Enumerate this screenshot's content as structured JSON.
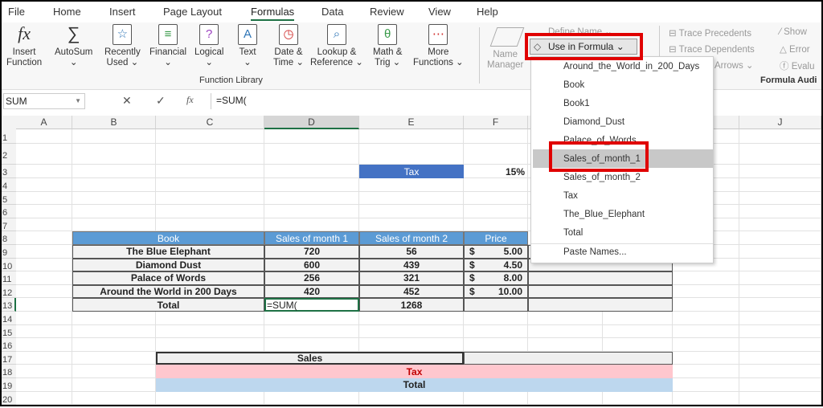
{
  "tabs": [
    "File",
    "Home",
    "Insert",
    "Page Layout",
    "Formulas",
    "Data",
    "Review",
    "View",
    "Help"
  ],
  "active_tab": "Formulas",
  "ribbon": {
    "function_library": [
      {
        "l1": "Insert",
        "l2": "Function",
        "icon": "fx-icon"
      },
      {
        "l1": "AutoSum",
        "l2": "⌄",
        "icon": "sigma-icon"
      },
      {
        "l1": "Recently",
        "l2": "Used ⌄",
        "icon": "star-book-icon"
      },
      {
        "l1": "Financial",
        "l2": "⌄",
        "icon": "financial-book-icon"
      },
      {
        "l1": "Logical",
        "l2": "⌄",
        "icon": "logical-book-icon"
      },
      {
        "l1": "Text",
        "l2": "⌄",
        "icon": "text-book-icon"
      },
      {
        "l1": "Date &",
        "l2": "Time ⌄",
        "icon": "clock-book-icon"
      },
      {
        "l1": "Lookup &",
        "l2": "Reference ⌄",
        "icon": "lookup-book-icon"
      },
      {
        "l1": "Math &",
        "l2": "Trig ⌄",
        "icon": "theta-book-icon"
      },
      {
        "l1": "More",
        "l2": "Functions ⌄",
        "icon": "more-book-icon"
      }
    ],
    "function_library_label": "Function Library",
    "name_manager": [
      "Name",
      "Manager"
    ],
    "define_name": "Define Name ⌄",
    "use_in_formula": "Use in Formula ⌄",
    "trace_precedents": "Trace Precedents",
    "trace_dependents": "Trace Dependents",
    "remove_arrows": "e Arrows ⌄",
    "show": "Show",
    "error": "Error",
    "evaluate": "Evalu",
    "formula_auditing_label": "Formula Audi"
  },
  "formula_bar": {
    "name_box": "SUM",
    "formula": "=SUM("
  },
  "columns": [
    "A",
    "B",
    "C",
    "D",
    "E",
    "F",
    "J"
  ],
  "rows": [
    "1",
    "2",
    "3",
    "4",
    "5",
    "6",
    "7",
    "8",
    "9",
    "10",
    "11",
    "12",
    "13",
    "14",
    "15",
    "16",
    "17",
    "18",
    "19",
    "20"
  ],
  "sheet": {
    "tax_label": "Tax",
    "tax_value": "15%",
    "headers": [
      "Book",
      "Sales of month 1",
      "Sales of month 2",
      "Price"
    ],
    "data": [
      [
        "The Blue Elephant",
        "720",
        "56",
        "$",
        "5.00"
      ],
      [
        "Diamond Dust",
        "600",
        "439",
        "$",
        "4.50"
      ],
      [
        "Palace of Words",
        "256",
        "321",
        "$",
        "8.00"
      ],
      [
        "Around the World in 200 Days",
        "420",
        "452",
        "$",
        "10.00"
      ]
    ],
    "total_label": "Total",
    "total_d": "=SUM(",
    "total_e": "1268",
    "summary": [
      "Sales",
      "Tax",
      "Total"
    ]
  },
  "menu": {
    "items": [
      "Around_the_World_in_200_Days",
      "Book",
      "Book1",
      "Diamond_Dust",
      "Palace_of_Words",
      "Sales_of_month_1",
      "Sales_of_month_2",
      "Tax",
      "The_Blue_Elephant",
      "Total"
    ],
    "highlighted": "Sales_of_month_1",
    "paste_names": "Paste Names..."
  },
  "colors": {
    "header_blue": "#5b9bd5",
    "tax_blue": "#4472c4",
    "pink": "#ffc7ce",
    "light_blue": "#bdd7ee",
    "highlight_red": "#e00000",
    "excel_green": "#1e7145"
  }
}
